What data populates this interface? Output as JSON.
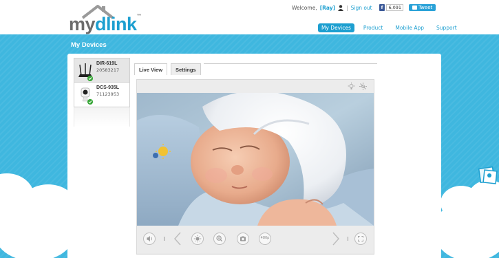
{
  "header": {
    "logo_my": "my",
    "logo_dlink": "dlink",
    "logo_tm": "™",
    "welcome": "Welcome,",
    "username": "[Ray]",
    "sep": "|",
    "signout": "Sign out",
    "fb_label": "f",
    "fb_count": "6,091",
    "tweet": "Tweet"
  },
  "nav": {
    "items": [
      {
        "label": "My Devices",
        "active": true
      },
      {
        "label": "Product",
        "active": false
      },
      {
        "label": "Mobile App",
        "active": false
      },
      {
        "label": "Support",
        "active": false
      }
    ]
  },
  "page": {
    "title": "My Devices"
  },
  "devices": [
    {
      "name": "DIR-619L",
      "id": "20583217",
      "status": "online",
      "icon": "router-icon"
    },
    {
      "name": "DCS-935L",
      "id": "71123953",
      "status": "online",
      "icon": "camera-icon"
    }
  ],
  "tabs": [
    {
      "label": "Live View",
      "active": true
    },
    {
      "label": "Settings",
      "active": false
    }
  ],
  "viewer": {
    "top_icons": [
      "night-vision-icon",
      "ir-light-icon"
    ],
    "controls": [
      {
        "name": "audio-icon"
      },
      {
        "name": "previous-icon"
      },
      {
        "name": "brightness-icon"
      },
      {
        "name": "zoom-icon"
      },
      {
        "name": "snapshot-icon"
      },
      {
        "name": "resolution-button",
        "label": "480p"
      },
      {
        "name": "next-icon"
      },
      {
        "name": "fullscreen-icon"
      }
    ]
  },
  "colors": {
    "brand": "#1d9fd0",
    "band": "#3fb7df",
    "online": "#3aa83a"
  }
}
